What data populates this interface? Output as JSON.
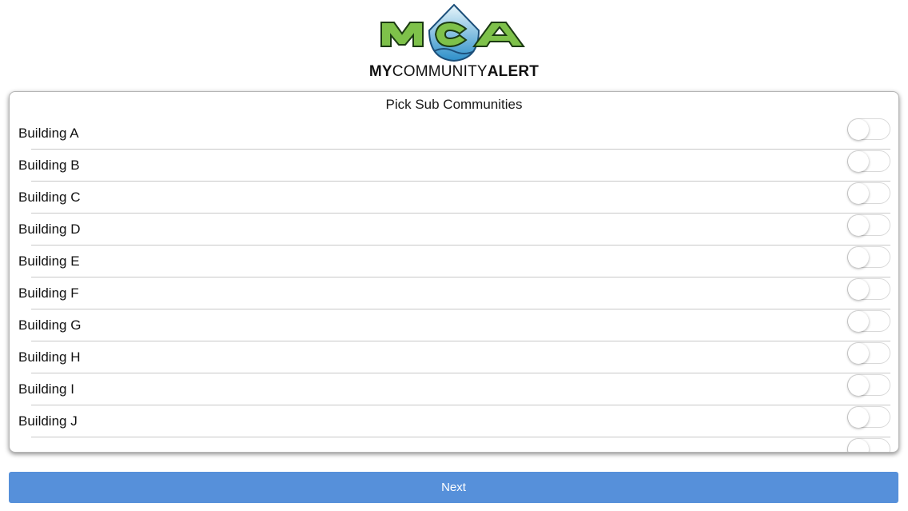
{
  "logo": {
    "mark_text": "MCA",
    "wordmark": {
      "part1": "MY",
      "part2": "COMMUNITY",
      "part3": "ALERT"
    }
  },
  "card": {
    "title": "Pick Sub Communities",
    "items": [
      {
        "label": "Building A",
        "enabled": false
      },
      {
        "label": "Building B",
        "enabled": false
      },
      {
        "label": "Building C",
        "enabled": false
      },
      {
        "label": "Building D",
        "enabled": false
      },
      {
        "label": "Building E",
        "enabled": false
      },
      {
        "label": "Building F",
        "enabled": false
      },
      {
        "label": "Building G",
        "enabled": false
      },
      {
        "label": "Building H",
        "enabled": false
      },
      {
        "label": "Building I",
        "enabled": false
      },
      {
        "label": "Building J",
        "enabled": false
      }
    ]
  },
  "next_button": {
    "label": "Next"
  },
  "colors": {
    "accent_button": "#5690da",
    "logo_green": "#7ec14a",
    "logo_blue": "#2d8fc9"
  }
}
